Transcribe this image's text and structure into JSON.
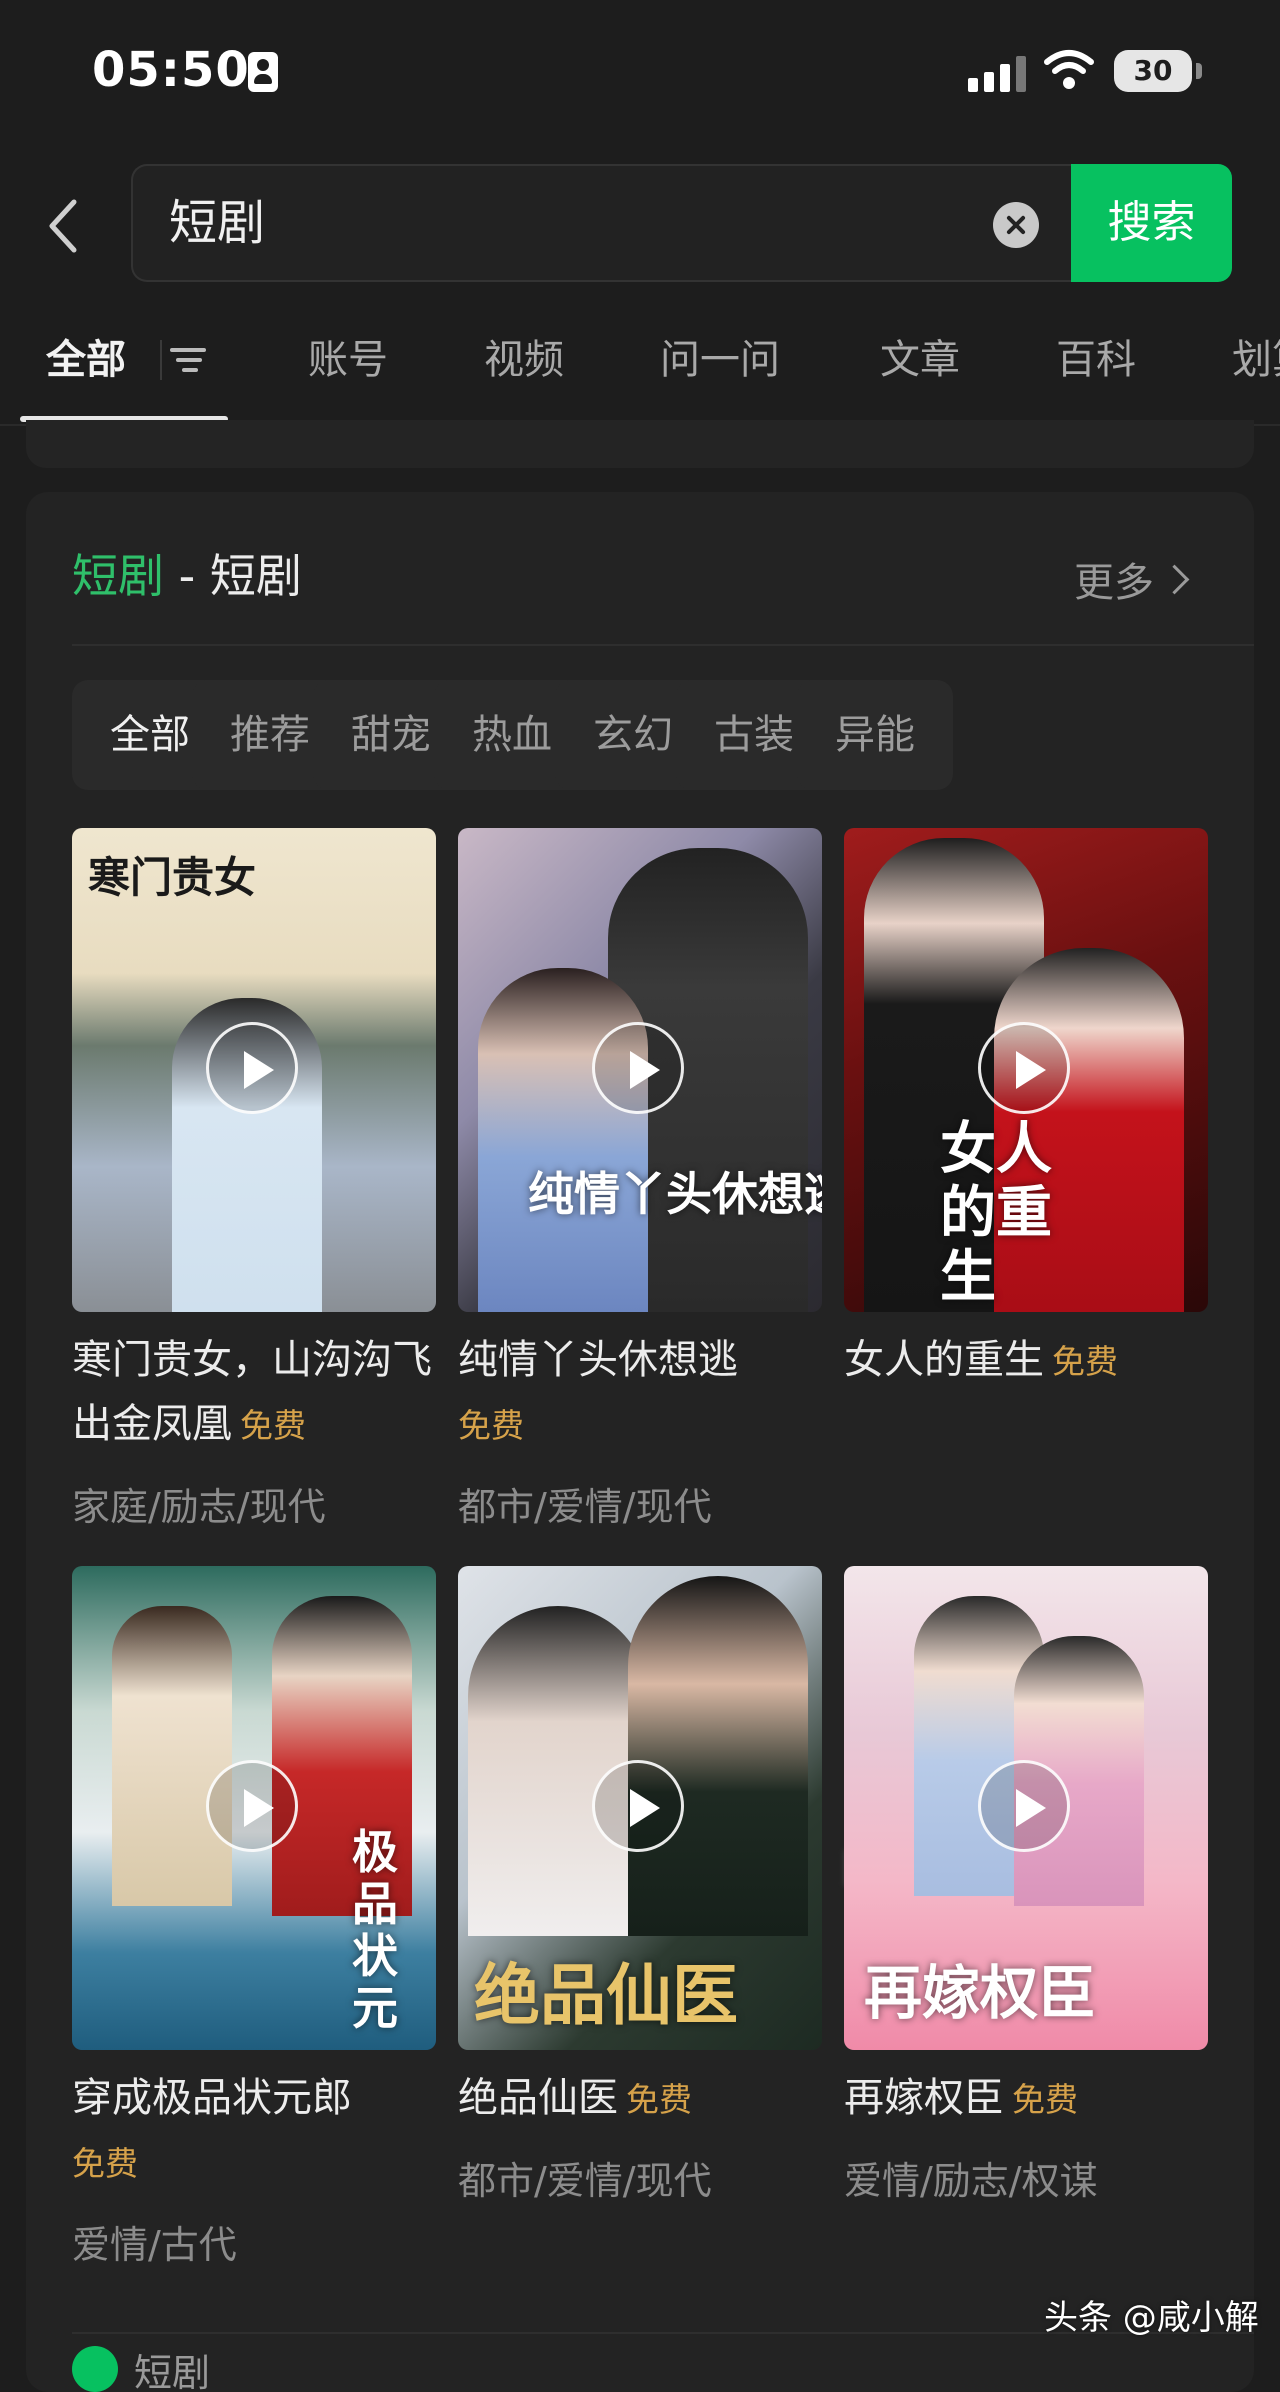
{
  "status_bar": {
    "time": "05:50",
    "battery": "30"
  },
  "search": {
    "query": "短剧",
    "button_label": "搜索"
  },
  "tabs": [
    {
      "label": "全部"
    },
    {
      "label": "账号"
    },
    {
      "label": "视频"
    },
    {
      "label": "问一问"
    },
    {
      "label": "文章"
    },
    {
      "label": "百科"
    },
    {
      "label": "划算"
    }
  ],
  "card": {
    "title_highlight": "短剧",
    "title_rest": " - 短剧",
    "more_label": "更多",
    "chips": [
      "全部",
      "推荐",
      "甜宠",
      "热血",
      "玄幻",
      "古装",
      "异能"
    ],
    "items": [
      {
        "title": "寒门贵女，山沟沟飞出金凤凰",
        "badge": "免费",
        "genre": "家庭/励志/现代",
        "poster_text": "寒门贵女"
      },
      {
        "title": "纯情丫头休想逃",
        "badge": "免费",
        "genre": "都市/爱情/现代",
        "poster_text": "纯情丫头休想逃"
      },
      {
        "title": "女人的重生",
        "badge": "免费",
        "genre": "",
        "poster_text": "女人的重生"
      },
      {
        "title": "穿成极品状元郎",
        "badge": "免费",
        "genre": "爱情/古代",
        "poster_text": "极品状元"
      },
      {
        "title": "绝品仙医",
        "badge": "免费",
        "genre": "都市/爱情/现代",
        "poster_text": "绝品仙医"
      },
      {
        "title": "再嫁权臣",
        "badge": "免费",
        "genre": "爱情/励志/权谋",
        "poster_text": "再嫁权臣"
      }
    ],
    "next_section_label": "短剧"
  },
  "watermark": "头条 @咸小解",
  "colors": {
    "accent": "#07c160",
    "free_badge": "#d6a24a",
    "background": "#1d1d1d"
  }
}
